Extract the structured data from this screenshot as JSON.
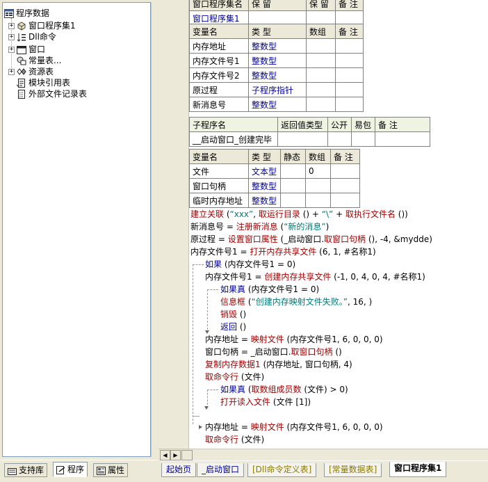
{
  "tree": {
    "root": "程序数据",
    "items": [
      {
        "label": "窗口程序集1",
        "expandable": true
      },
      {
        "label": "Dll命令",
        "expandable": true
      },
      {
        "label": "窗口",
        "expandable": true
      },
      {
        "label": "常量表...",
        "expandable": false
      },
      {
        "label": "资源表",
        "expandable": true
      },
      {
        "label": "模块引用表",
        "expandable": false
      },
      {
        "label": "外部文件记录表",
        "expandable": false
      }
    ]
  },
  "left_tabs": [
    "支持库",
    "程序",
    "属性"
  ],
  "assembly_table": {
    "headers": [
      "窗口程序集名",
      "保 留",
      "保 留",
      "备 注"
    ],
    "row": [
      "窗口程序集1",
      "",
      "",
      ""
    ]
  },
  "assembly_vars": {
    "headers": [
      "变量名",
      "类 型",
      "数组",
      "备 注"
    ],
    "rows": [
      [
        "内存地址",
        "整数型",
        "",
        ""
      ],
      [
        "内存文件号1",
        "整数型",
        "",
        ""
      ],
      [
        "内存文件号2",
        "整数型",
        "",
        ""
      ],
      [
        "原过程",
        "子程序指针",
        "",
        ""
      ],
      [
        "新消息号",
        "整数型",
        "",
        ""
      ]
    ]
  },
  "sub_table": {
    "headers": [
      "子程序名",
      "返回值类型",
      "公开",
      "易包",
      "备 注"
    ],
    "row": [
      "__启动窗口_创建完毕",
      "",
      "",
      "",
      ""
    ]
  },
  "local_vars": {
    "headers": [
      "变量名",
      "类 型",
      "静态",
      "数组",
      "备 注"
    ],
    "rows": [
      [
        "文件",
        "文本型",
        "",
        "0",
        ""
      ],
      [
        "窗口句柄",
        "整数型",
        "",
        "",
        ""
      ],
      [
        "临时内存地址",
        "整数型",
        "",
        "",
        ""
      ]
    ]
  },
  "code": {
    "line1": {
      "a": "建立关联",
      "b": " (",
      "c": "“xxx”",
      "d": ", ",
      "e": "取运行目录",
      "f": " () + ",
      "g": "“\\”",
      "h": " + ",
      "i": "取执行文件名",
      "j": " ())"
    },
    "line2": {
      "a": "新消息号 = ",
      "b": "注册新消息",
      "c": " (",
      "d": "“新的消息”",
      "e": ")"
    },
    "line3": {
      "a": "原过程 = ",
      "b": "设置窗口属性",
      "c": " (_启动窗口.",
      "d": "取窗口句柄",
      "e": " (), -4, &mydde)"
    },
    "line4": {
      "a": "内存文件号1 = ",
      "b": "打开内存共享文件",
      "c": " (6, 1, #名称1)"
    },
    "line5": {
      "a": "如果",
      "b": " (内存文件号1 = 0)"
    },
    "line6": {
      "a": "内存文件号1 = ",
      "b": "创建内存共享文件",
      "c": " (-1, 0, 4, 0, 4, #名称1)"
    },
    "line7": {
      "a": "如果真",
      "b": " (内存文件号1 = 0)"
    },
    "line8": {
      "a": "信息框",
      "b": " (",
      "c": "“创建内存映射文件失败。”",
      "d": ", 16, )"
    },
    "line9": {
      "a": "销毁",
      "b": " ()"
    },
    "line10": {
      "a": "返回",
      "b": " ()"
    },
    "line11": {
      "a": "内存地址 = ",
      "b": "映射文件",
      "c": " (内存文件号1, 6, 0, 0, 0)"
    },
    "line12": {
      "a": "窗口句柄 = _启动窗口.",
      "b": "取窗口句柄",
      "c": " ()"
    },
    "line13": {
      "a": "复制内存数据1",
      "b": " (内存地址, 窗口句柄, 4)"
    },
    "line14": {
      "a": "取命令行",
      "b": " (文件)"
    },
    "line15": {
      "a": "如果真",
      "b": " (",
      "c": "取数组成员数",
      "d": " (文件) > 0)"
    },
    "line16": {
      "a": "打开读入文件",
      "b": " (文件 [1])"
    },
    "line17": {
      "a": "内存地址 = ",
      "b": "映射文件",
      "c": " (内存文件号1, 6, 0, 0, 0)"
    },
    "line18": {
      "a": "取命令行",
      "b": " (文件)"
    }
  },
  "doc_tabs": [
    "起始页",
    "_启动窗口",
    "[Dll命令定义表]",
    "[常量数据表]",
    "窗口程序集1"
  ]
}
